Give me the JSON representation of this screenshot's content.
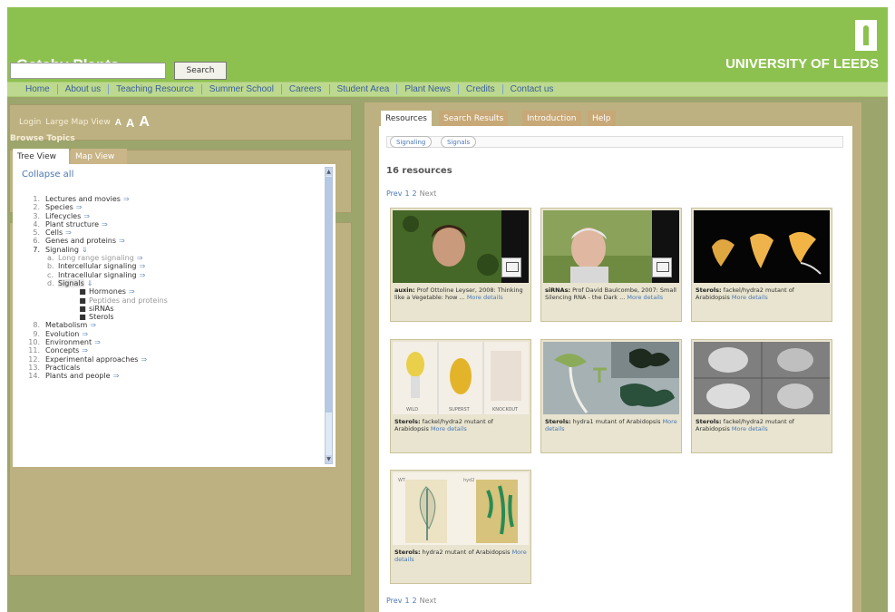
{
  "header": {
    "site_title": "Gatsby Plants",
    "university": "UNIVERSITY OF LEEDS",
    "logo_icon": "university-tower-logo"
  },
  "nav": [
    "Home",
    "About us",
    "Teaching Resource",
    "Summer School",
    "Careers",
    "Student Area",
    "Plant News",
    "Credits",
    "Contact us"
  ],
  "left": {
    "login": "Login",
    "large_map_view": "Large Map View",
    "font_sizes": [
      "A",
      "A",
      "A"
    ],
    "search_button": "Search",
    "search_value": "",
    "browse_title": "Browse Topics",
    "tabs": [
      "Tree View",
      "Map View"
    ],
    "collapse_all": "Collapse all",
    "tree": [
      {
        "num": "1.",
        "label": "Lectures and movies"
      },
      {
        "num": "2.",
        "label": "Species"
      },
      {
        "num": "3.",
        "label": "Lifecycles"
      },
      {
        "num": "4.",
        "label": "Plant structure"
      },
      {
        "num": "5.",
        "label": "Cells"
      },
      {
        "num": "6.",
        "label": "Genes and proteins"
      },
      {
        "num": "7.",
        "label": "Signaling"
      },
      {
        "num": "a.",
        "label": "Long range signaling"
      },
      {
        "num": "b.",
        "label": "Intercellular signaling"
      },
      {
        "num": "c.",
        "label": "Intracellular signaling"
      },
      {
        "num": "d.",
        "label": "Signals"
      },
      {
        "label": "Hormones"
      },
      {
        "label": "Peptides and proteins"
      },
      {
        "label": "siRNAs"
      },
      {
        "label": "Sterols"
      },
      {
        "num": "8.",
        "label": "Metabolism"
      },
      {
        "num": "9.",
        "label": "Evolution"
      },
      {
        "num": "10.",
        "label": "Environment"
      },
      {
        "num": "11.",
        "label": "Concepts"
      },
      {
        "num": "12.",
        "label": "Experimental approaches"
      },
      {
        "num": "13.",
        "label": "Practicals"
      },
      {
        "num": "14.",
        "label": "Plants and people"
      }
    ]
  },
  "right": {
    "tabs": [
      "Resources",
      "Search Results",
      "Introduction",
      "Help"
    ],
    "filters": [
      "Signaling",
      "Signals"
    ],
    "resource_count": "16 resources",
    "pager": {
      "prev": "Prev",
      "pages": [
        "1",
        "2"
      ],
      "next": "Next"
    },
    "cards": [
      {
        "title": "auxin:",
        "text": "Prof Ottoline Leyser, 2008: Thinking like a Vegetable: how ...",
        "more": "More details"
      },
      {
        "title": "siRNAs:",
        "text": "Prof David Baulcombe, 2007: Small Silencing RNA - the Dark ...",
        "more": "More details"
      },
      {
        "title": "Sterols:",
        "text": "fackel/hydra2 mutant of Arabidopsis",
        "more": "More details"
      },
      {
        "title": "Sterols:",
        "text": "fackel/hydra2 mutant of Arabidopsis",
        "more": "More details"
      },
      {
        "title": "Sterols:",
        "text": "hydra1 mutant of Arabidopsis",
        "more": "More details"
      },
      {
        "title": "Sterols:",
        "text": "fackel/hydra2 mutant of Arabidopsis",
        "more": "More details"
      },
      {
        "title": "Sterols:",
        "text": "hydra2 mutant of Arabidopsis",
        "more": "More details"
      }
    ],
    "card3_panel_labels": [
      "WILD",
      "SUPERST",
      "KNOCKOUT"
    ],
    "card7_panel_labels": [
      "WT",
      "hyd2"
    ]
  }
}
